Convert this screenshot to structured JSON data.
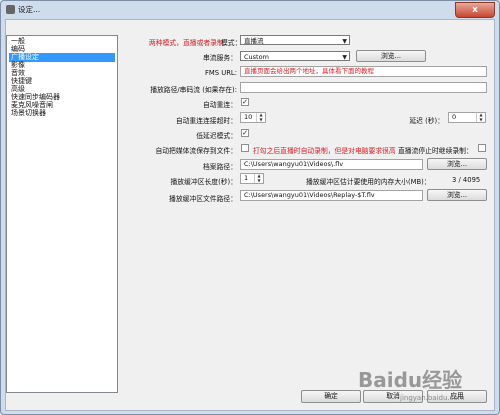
{
  "window": {
    "title": "设定...",
    "close_label": "x"
  },
  "sidebar": {
    "items": [
      {
        "label": "一般"
      },
      {
        "label": "编码"
      },
      {
        "label": "广播设定",
        "selected": true
      },
      {
        "label": "影像"
      },
      {
        "label": "音效"
      },
      {
        "label": "快捷键"
      },
      {
        "label": "高级"
      },
      {
        "label": "快速同步编码器"
      },
      {
        "label": "麦克风噪音闸"
      },
      {
        "label": "场景切换器"
      }
    ]
  },
  "settings": {
    "mode": {
      "annotation": "两种模式，直播或者录制",
      "label": "模式：",
      "value": "直播流"
    },
    "service": {
      "label": "串流服务：",
      "value": "Custom",
      "browse": "浏览..."
    },
    "fms_url": {
      "label": "FMS URL:",
      "annotation": "直播页面会给出两个地址，具体看下面的教程"
    },
    "playpath": {
      "label": "播放路径/串码流 (如果存在):"
    },
    "auto_reconnect": {
      "label": "自动重连：",
      "checked": true
    },
    "reconnect_timeout": {
      "label": "自动重连连接超时：",
      "value": "10"
    },
    "delay": {
      "label": "延迟 (秒)：",
      "value": "0"
    },
    "low_latency": {
      "label": "低延迟模式：",
      "checked": true
    },
    "autosave": {
      "label": "自动把媒体流保存到文件：",
      "checked": false,
      "annotation": "打勾之后直播时自动录制，但是对电脑要求很高"
    },
    "stop_record": {
      "label": "直播流停止时继续录制：",
      "checked": false
    },
    "file_path": {
      "label": "档案路径：",
      "value": "C:\\Users\\wangyu01\\Videos\\.flv",
      "browse": "浏览..."
    },
    "replay_buffer": {
      "label": "播放缓冲区长度(秒)：",
      "value": "1"
    },
    "buffer_memory": {
      "label": "播放缓冲区估计要使用的内存大小(MB)：",
      "value": "3 / 4095"
    },
    "buffer_file": {
      "label": "播放缓冲区文件路径：",
      "value": "C:\\Users\\wangyu01\\Videos\\Replay-$T.flv",
      "browse": "浏览..."
    }
  },
  "footer": {
    "ok": "确定",
    "cancel": "取消",
    "apply": "应用"
  },
  "watermark": {
    "brand": "Baidu经验",
    "url": "jingyan.baidu.com"
  }
}
